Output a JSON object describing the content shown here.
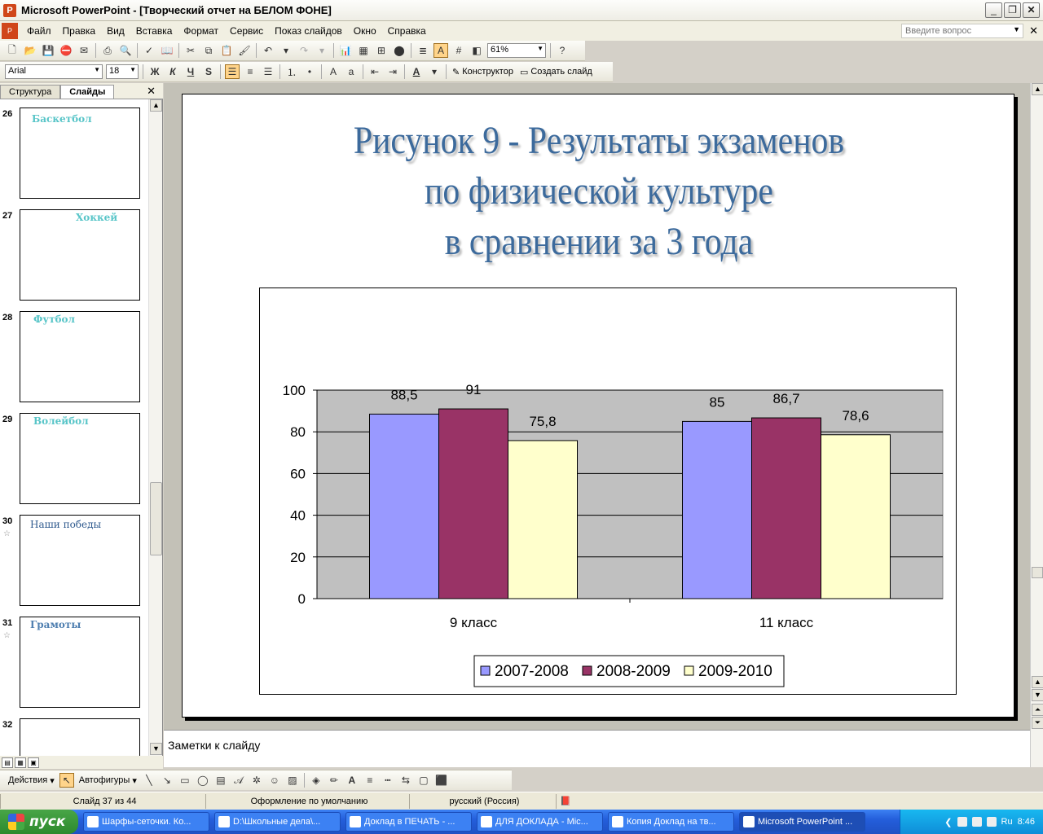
{
  "window": {
    "title": "Microsoft PowerPoint - [Творческий отчет на БЕЛОМ ФОНЕ]"
  },
  "menu": {
    "items": [
      "Файл",
      "Правка",
      "Вид",
      "Вставка",
      "Формат",
      "Сервис",
      "Показ слайдов",
      "Окно",
      "Справка"
    ],
    "help_placeholder": "Введите вопрос"
  },
  "toolbar": {
    "zoom": "61%",
    "font_name": "Arial",
    "font_size": "18",
    "bold_label": "Ж",
    "italic_label": "К",
    "underline_label": "Ч",
    "shadow_label": "S",
    "designer_label": "Конструктор",
    "new_slide_label": "Создать слайд"
  },
  "slide_pane": {
    "tabs": [
      "Структура",
      "Слайды"
    ],
    "thumbnails": [
      {
        "num": "26",
        "text": "Баскетбол",
        "starred": false
      },
      {
        "num": "27",
        "text": "Хоккей",
        "starred": false
      },
      {
        "num": "28",
        "text": "Футбол",
        "starred": false
      },
      {
        "num": "29",
        "text": "Волейбол",
        "starred": false
      },
      {
        "num": "30",
        "text": "Наши победы",
        "starred": true
      },
      {
        "num": "31",
        "text": "Грамоты",
        "starred": true
      },
      {
        "num": "32",
        "text": "",
        "starred": false
      }
    ]
  },
  "slide": {
    "title_lines": [
      "Рисунок 9 - Результаты экзаменов",
      "по физической культуре",
      "в сравнении за 3 года"
    ]
  },
  "chart_data": {
    "type": "bar",
    "categories": [
      "9 класс",
      "11 класс"
    ],
    "series": [
      {
        "name": "2007-2008",
        "values": [
          88.5,
          85
        ],
        "color": "#9999ff",
        "labels": [
          "88,5",
          "85"
        ]
      },
      {
        "name": "2008-2009",
        "values": [
          91,
          86.7
        ],
        "color": "#993366",
        "labels": [
          "91",
          "86,7"
        ]
      },
      {
        "name": "2009-2010",
        "values": [
          75.8,
          78.6
        ],
        "color": "#ffffcc",
        "labels": [
          "75,8",
          "78,6"
        ]
      }
    ],
    "ylim": [
      0,
      100
    ],
    "yticks": [
      0,
      20,
      40,
      60,
      80,
      100
    ],
    "grid": true,
    "plot_background": "#c0c0c0",
    "legend_position": "bottom"
  },
  "notes": {
    "placeholder": "Заметки к слайду"
  },
  "drawing_toolbar": {
    "actions_label": "Действия",
    "autoshapes_label": "Автофигуры"
  },
  "status": {
    "slide_info": "Слайд 37 из 44",
    "design": "Оформление по умолчанию",
    "language": "русский (Россия)"
  },
  "taskbar": {
    "start_label": "пуск",
    "tasks": [
      "Шарфы-сеточки. Ко...",
      "D:\\Школьные дела\\...",
      "Доклад в ПЕЧАТЬ - ...",
      "ДЛЯ ДОКЛАДА - Mic...",
      "Копия Доклад на тв...",
      "Microsoft PowerPoint ..."
    ],
    "tray_lang": "Ru",
    "clock": "8:46"
  }
}
